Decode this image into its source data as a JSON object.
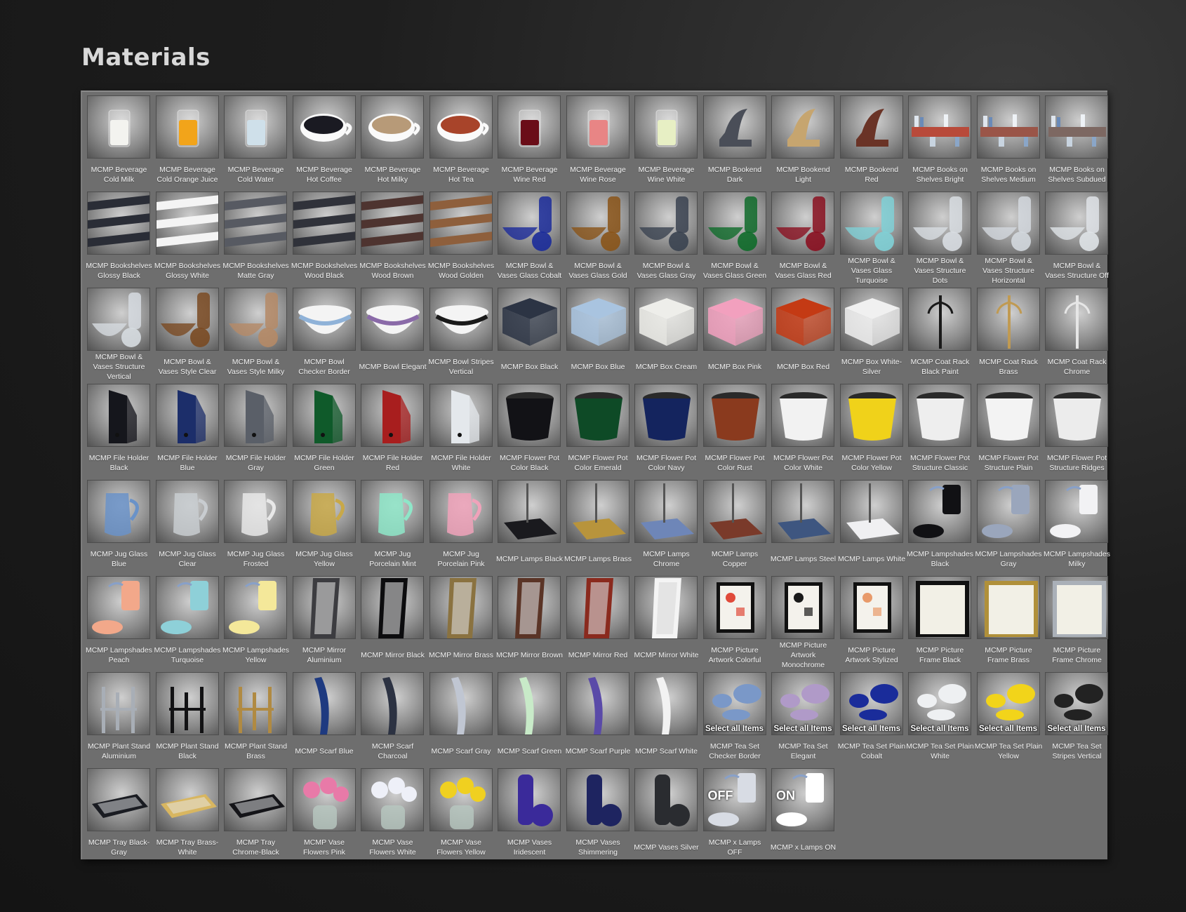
{
  "page": {
    "title": "Materials"
  },
  "columns": 15,
  "items": [
    {
      "label": "MCMP Beverage Cold Milk",
      "icon": "glass-milk-icon",
      "color": "#f3f3ef",
      "kind": "glass"
    },
    {
      "label": "MCMP Beverage Cold Orange Juice",
      "icon": "glass-orange-juice-icon",
      "color": "#f2a41a",
      "kind": "glass"
    },
    {
      "label": "MCMP Beverage Cold Water",
      "icon": "glass-water-icon",
      "color": "#cfe0ea",
      "kind": "glass"
    },
    {
      "label": "MCMP Beverage Hot Coffee",
      "icon": "cup-coffee-icon",
      "color": "#1a1a22",
      "kind": "cup"
    },
    {
      "label": "MCMP Beverage Hot Milky",
      "icon": "cup-milky-icon",
      "color": "#b79a78",
      "kind": "cup"
    },
    {
      "label": "MCMP Beverage Hot Tea",
      "icon": "cup-tea-icon",
      "color": "#a8442a",
      "kind": "cup"
    },
    {
      "label": "MCMP Beverage Wine Red",
      "icon": "wine-glass-red-icon",
      "color": "#6a0d18",
      "kind": "glass"
    },
    {
      "label": "MCMP Beverage Wine Rose",
      "icon": "wine-glass-rose-icon",
      "color": "#e88585",
      "kind": "glass"
    },
    {
      "label": "MCMP Beverage Wine White",
      "icon": "wine-glass-white-icon",
      "color": "#e7efc4",
      "kind": "glass"
    },
    {
      "label": "MCMP Bookend Dark",
      "icon": "bookend-dark-icon",
      "color": "#4a4e58",
      "kind": "bookend"
    },
    {
      "label": "MCMP Bookend Light",
      "icon": "bookend-light-icon",
      "color": "#c6a56f",
      "kind": "bookend"
    },
    {
      "label": "MCMP Bookend Red",
      "icon": "bookend-red-icon",
      "color": "#6a3326",
      "kind": "bookend"
    },
    {
      "label": "MCMP Books on Shelves Bright",
      "icon": "books-shelves-bright-icon",
      "color": "#b84a3a",
      "kind": "books"
    },
    {
      "label": "MCMP Books on Shelves Medium",
      "icon": "books-shelves-medium-icon",
      "color": "#9a5548",
      "kind": "books"
    },
    {
      "label": "MCMP Books on Shelves Subdued",
      "icon": "books-shelves-subdued-icon",
      "color": "#7d6862",
      "kind": "books"
    },
    {
      "label": "MCMP Bookshelves Glossy Black",
      "icon": "shelves-glossy-black-icon",
      "color": "#2a2d36",
      "kind": "shelves"
    },
    {
      "label": "MCMP Bookshelves Glossy White",
      "icon": "shelves-glossy-white-icon",
      "color": "#f4f4f4",
      "kind": "shelves"
    },
    {
      "label": "MCMP Bookshelves Matte Gray",
      "icon": "shelves-matte-gray-icon",
      "color": "#575a62",
      "kind": "shelves"
    },
    {
      "label": "MCMP Bookshelves Wood Black",
      "icon": "shelves-wood-black-icon",
      "color": "#30323a",
      "kind": "shelves"
    },
    {
      "label": "MCMP Bookshelves Wood Brown",
      "icon": "shelves-wood-brown-icon",
      "color": "#4e3430",
      "kind": "shelves"
    },
    {
      "label": "MCMP Bookshelves Wood Golden",
      "icon": "shelves-wood-golden-icon",
      "color": "#8e5f3c",
      "kind": "shelves"
    },
    {
      "label": "MCMP Bowl & Vases Glass Cobalt",
      "icon": "bowl-vases-cobalt-icon",
      "color": "#1b2b9a",
      "kind": "bowlvase"
    },
    {
      "label": "MCMP Bowl & Vases Glass Gold",
      "icon": "bowl-vases-gold-icon",
      "color": "#8a5418",
      "kind": "bowlvase"
    },
    {
      "label": "MCMP Bowl & Vases Glass Gray",
      "icon": "bowl-vases-gray-icon",
      "color": "#3a4250",
      "kind": "bowlvase"
    },
    {
      "label": "MCMP Bowl & Vases Glass Green",
      "icon": "bowl-vases-green-icon",
      "color": "#0f6b2a",
      "kind": "bowlvase"
    },
    {
      "label": "MCMP Bowl & Vases Glass Red",
      "icon": "bowl-vases-red-icon",
      "color": "#8a1020",
      "kind": "bowlvase"
    },
    {
      "label": "MCMP Bowl & Vases Glass Turquoise",
      "icon": "bowl-vases-turquoise-icon",
      "color": "#7fd0d6",
      "kind": "bowlvase"
    },
    {
      "label": "MCMP Bowl & Vases Structure Dots",
      "icon": "bowl-vases-dots-icon",
      "color": "#d8dde2",
      "kind": "bowlvase"
    },
    {
      "label": "MCMP Bowl & Vases Structure Horizontal",
      "icon": "bowl-vases-horizontal-icon",
      "color": "#d3d8de",
      "kind": "bowlvase"
    },
    {
      "label": "MCMP Bowl & Vases Structure Off",
      "icon": "bowl-vases-off-icon",
      "color": "#dfe3e7",
      "kind": "bowlvase"
    },
    {
      "label": "MCMP Bowl & Vases Structure Vertical",
      "icon": "bowl-vases-vertical-icon",
      "color": "#d6dbe0",
      "kind": "bowlvase"
    },
    {
      "label": "MCMP Bowl & Vases Style Clear",
      "icon": "bowl-vases-style-clear-icon",
      "color": "#7a4a22",
      "kind": "bowlvase"
    },
    {
      "label": "MCMP Bowl & Vases Style Milky",
      "icon": "bowl-vases-style-milky-icon",
      "color": "#b58a66",
      "kind": "bowlvase"
    },
    {
      "label": "MCMP Bowl Checker Border",
      "icon": "bowl-checker-border-icon",
      "color": "#8fb2d8",
      "kind": "bowl"
    },
    {
      "label": "MCMP Bowl Elegant",
      "icon": "bowl-elegant-icon",
      "color": "#8a6aa8",
      "kind": "bowl"
    },
    {
      "label": "MCMP Bowl Stripes Vertical",
      "icon": "bowl-stripes-vertical-icon",
      "color": "#1a1a1a",
      "kind": "bowl"
    },
    {
      "label": "MCMP Box Black",
      "icon": "box-black-icon",
      "color": "#2c3444",
      "kind": "box"
    },
    {
      "label": "MCMP Box Blue",
      "icon": "box-blue-icon",
      "color": "#a9c4e0",
      "kind": "box"
    },
    {
      "label": "MCMP Box Cream",
      "icon": "box-cream-icon",
      "color": "#eeeeea",
      "kind": "box"
    },
    {
      "label": "MCMP Box Pink",
      "icon": "box-pink-icon",
      "color": "#f2a0be",
      "kind": "box"
    },
    {
      "label": "MCMP Box Red",
      "icon": "box-red-icon",
      "color": "#c43a14",
      "kind": "box"
    },
    {
      "label": "MCMP Box White-Silver",
      "icon": "box-white-silver-icon",
      "color": "#f0f0f0",
      "kind": "box"
    },
    {
      "label": "MCMP Coat Rack Black Paint",
      "icon": "coat-rack-black-icon",
      "color": "#1a1a1a",
      "kind": "rack"
    },
    {
      "label": "MCMP Coat Rack Brass",
      "icon": "coat-rack-brass-icon",
      "color": "#c09a52",
      "kind": "rack"
    },
    {
      "label": "MCMP Coat Rack Chrome",
      "icon": "coat-rack-chrome-icon",
      "color": "#e6e6e6",
      "kind": "rack"
    },
    {
      "label": "MCMP File Holder Black",
      "icon": "file-holder-black-icon",
      "color": "#15161c",
      "kind": "file"
    },
    {
      "label": "MCMP File Holder Blue",
      "icon": "file-holder-blue-icon",
      "color": "#1c2e6a",
      "kind": "file"
    },
    {
      "label": "MCMP File Holder Gray",
      "icon": "file-holder-gray-icon",
      "color": "#5a5f68",
      "kind": "file"
    },
    {
      "label": "MCMP File Holder Green",
      "icon": "file-holder-green-icon",
      "color": "#0f5a2a",
      "kind": "file"
    },
    {
      "label": "MCMP File Holder Red",
      "icon": "file-holder-red-icon",
      "color": "#a81e1e",
      "kind": "file"
    },
    {
      "label": "MCMP File Holder White",
      "icon": "file-holder-white-icon",
      "color": "#e4e8ec",
      "kind": "file"
    },
    {
      "label": "MCMP Flower Pot Color Black",
      "icon": "flower-pot-black-icon",
      "color": "#121216",
      "kind": "pot"
    },
    {
      "label": "MCMP Flower Pot Color Emerald",
      "icon": "flower-pot-emerald-icon",
      "color": "#0e4a26",
      "kind": "pot"
    },
    {
      "label": "MCMP Flower Pot Color Navy",
      "icon": "flower-pot-navy-icon",
      "color": "#14245e",
      "kind": "pot"
    },
    {
      "label": "MCMP Flower Pot Color Rust",
      "icon": "flower-pot-rust-icon",
      "color": "#8a3a1e",
      "kind": "pot"
    },
    {
      "label": "MCMP Flower Pot Color White",
      "icon": "flower-pot-white-icon",
      "color": "#f2f2f2",
      "kind": "pot"
    },
    {
      "label": "MCMP Flower Pot Color Yellow",
      "icon": "flower-pot-yellow-icon",
      "color": "#f0d21a",
      "kind": "pot"
    },
    {
      "label": "MCMP Flower Pot Structure Classic",
      "icon": "flower-pot-classic-icon",
      "color": "#eeeeee",
      "kind": "pot"
    },
    {
      "label": "MCMP Flower Pot Structure Plain",
      "icon": "flower-pot-plain-icon",
      "color": "#f3f3f3",
      "kind": "pot"
    },
    {
      "label": "MCMP Flower Pot Structure Ridges",
      "icon": "flower-pot-ridges-icon",
      "color": "#ececec",
      "kind": "pot"
    },
    {
      "label": "MCMP Jug Glass Blue",
      "icon": "jug-glass-blue-icon",
      "color": "#6a92c8",
      "kind": "jug"
    },
    {
      "label": "MCMP Jug Glass Clear",
      "icon": "jug-glass-clear-icon",
      "color": "#c8ccd0",
      "kind": "jug"
    },
    {
      "label": "MCMP Jug Glass Frosted",
      "icon": "jug-glass-frosted-icon",
      "color": "#e8e8e8",
      "kind": "jug"
    },
    {
      "label": "MCMP Jug Glass Yellow",
      "icon": "jug-glass-yellow-icon",
      "color": "#c8a848",
      "kind": "jug"
    },
    {
      "label": "MCMP Jug Porcelain Mint",
      "icon": "jug-porcelain-mint-icon",
      "color": "#8ee6c8",
      "kind": "jug"
    },
    {
      "label": "MCMP Jug Porcelain Pink",
      "icon": "jug-porcelain-pink-icon",
      "color": "#f0a2ba",
      "kind": "jug"
    },
    {
      "label": "MCMP Lamps Black",
      "icon": "lamp-black-icon",
      "color": "#1a1a1e",
      "kind": "lamp"
    },
    {
      "label": "MCMP Lamps Brass",
      "icon": "lamp-brass-icon",
      "color": "#b8943c",
      "kind": "lamp"
    },
    {
      "label": "MCMP Lamps Chrome",
      "icon": "lamp-chrome-icon",
      "color": "#6e86b8",
      "kind": "lamp"
    },
    {
      "label": "MCMP Lamps Copper",
      "icon": "lamp-copper-icon",
      "color": "#7a3a2a",
      "kind": "lamp"
    },
    {
      "label": "MCMP Lamps Steel",
      "icon": "lamp-steel-icon",
      "color": "#3e5680",
      "kind": "lamp"
    },
    {
      "label": "MCMP Lamps White",
      "icon": "lamp-white-icon",
      "color": "#f0f0f2",
      "kind": "lamp"
    },
    {
      "label": "MCMP Lampshades Black",
      "icon": "lampshade-black-icon",
      "color": "#111114",
      "kind": "shade"
    },
    {
      "label": "MCMP Lampshades Gray",
      "icon": "lampshade-gray-icon",
      "color": "#9aa6bc",
      "kind": "shade"
    },
    {
      "label": "MCMP Lampshades Milky",
      "icon": "lampshade-milky-icon",
      "color": "#f2f2f4",
      "kind": "shade"
    },
    {
      "label": "MCMP Lampshades Peach",
      "icon": "lampshade-peach-icon",
      "color": "#f2a88a",
      "kind": "shade"
    },
    {
      "label": "MCMP Lampshades Turquoise",
      "icon": "lampshade-turquoise-icon",
      "color": "#8ed0d8",
      "kind": "shade"
    },
    {
      "label": "MCMP Lampshades Yellow",
      "icon": "lampshade-yellow-icon",
      "color": "#f4e89a",
      "kind": "shade"
    },
    {
      "label": "MCMP Mirror Aluminium",
      "icon": "mirror-aluminium-icon",
      "color": "#3c3c40",
      "kind": "mirror"
    },
    {
      "label": "MCMP Mirror Black",
      "icon": "mirror-black-icon",
      "color": "#0c0c0e",
      "kind": "mirror"
    },
    {
      "label": "MCMP Mirror Brass",
      "icon": "mirror-brass-icon",
      "color": "#8a7240",
      "kind": "mirror"
    },
    {
      "label": "MCMP Mirror Brown",
      "icon": "mirror-brown-icon",
      "color": "#5a3426",
      "kind": "mirror"
    },
    {
      "label": "MCMP Mirror Red",
      "icon": "mirror-red-icon",
      "color": "#8a2a1e",
      "kind": "mirror"
    },
    {
      "label": "MCMP Mirror White",
      "icon": "mirror-white-icon",
      "color": "#f4f4f4",
      "kind": "mirror"
    },
    {
      "label": "MCMP Picture Artwork Colorful",
      "icon": "picture-colorful-icon",
      "color": "#e04a3a",
      "kind": "picture"
    },
    {
      "label": "MCMP Picture Artwork Monochrome",
      "icon": "picture-monochrome-icon",
      "color": "#1a1a1a",
      "kind": "picture"
    },
    {
      "label": "MCMP Picture Artwork Stylized",
      "icon": "picture-stylized-icon",
      "color": "#e89a6a",
      "kind": "picture"
    },
    {
      "label": "MCMP Picture Frame Black",
      "icon": "frame-black-icon",
      "color": "#111111",
      "kind": "frame"
    },
    {
      "label": "MCMP Picture Frame Brass",
      "icon": "frame-brass-icon",
      "color": "#b0903a",
      "kind": "frame"
    },
    {
      "label": "MCMP Picture Frame Chrome",
      "icon": "frame-chrome-icon",
      "color": "#aab0b8",
      "kind": "frame"
    },
    {
      "label": "MCMP Plant Stand Aluminium",
      "icon": "plant-stand-aluminium-icon",
      "color": "#a8aeb6",
      "kind": "stand"
    },
    {
      "label": "MCMP Plant Stand Black",
      "icon": "plant-stand-black-icon",
      "color": "#121214",
      "kind": "stand"
    },
    {
      "label": "MCMP Plant Stand Brass",
      "icon": "plant-stand-brass-icon",
      "color": "#b08a42",
      "kind": "stand"
    },
    {
      "label": "MCMP Scarf Blue",
      "icon": "scarf-blue-icon",
      "color": "#1e3a80",
      "kind": "scarf"
    },
    {
      "label": "MCMP Scarf Charcoal",
      "icon": "scarf-charcoal-icon",
      "color": "#2c3242",
      "kind": "scarf"
    },
    {
      "label": "MCMP Scarf Gray",
      "icon": "scarf-gray-icon",
      "color": "#c0c6d2",
      "kind": "scarf"
    },
    {
      "label": "MCMP Scarf Green",
      "icon": "scarf-green-icon",
      "color": "#c8eac8",
      "kind": "scarf"
    },
    {
      "label": "MCMP Scarf Purple",
      "icon": "scarf-purple-icon",
      "color": "#5a4aa8",
      "kind": "scarf"
    },
    {
      "label": "MCMP Scarf White",
      "icon": "scarf-white-icon",
      "color": "#f2f2f2",
      "kind": "scarf"
    },
    {
      "label": "MCMP Tea Set Checker Border",
      "icon": "tea-set-checker-icon",
      "color": "#7a98c8",
      "kind": "tea",
      "tag": "Select all Items"
    },
    {
      "label": "MCMP Tea Set Elegant",
      "icon": "tea-set-elegant-icon",
      "color": "#b09ac8",
      "kind": "tea",
      "tag": "Select all Items"
    },
    {
      "label": "MCMP Tea Set Plain Cobalt",
      "icon": "tea-set-cobalt-icon",
      "color": "#1a2c9a",
      "kind": "tea",
      "tag": "Select all Items"
    },
    {
      "label": "MCMP Tea Set Plain White",
      "icon": "tea-set-white-icon",
      "color": "#eef0f2",
      "kind": "tea",
      "tag": "Select all Items"
    },
    {
      "label": "MCMP Tea Set Plain Yellow",
      "icon": "tea-set-yellow-icon",
      "color": "#f2d41a",
      "kind": "tea",
      "tag": "Select all Items"
    },
    {
      "label": "MCMP Tea Set Stripes Vertical",
      "icon": "tea-set-stripes-icon",
      "color": "#222222",
      "kind": "tea",
      "tag": "Select all Items"
    },
    {
      "label": "MCMP Tray Black-Gray",
      "icon": "tray-black-gray-icon",
      "color": "#1a1c22",
      "kind": "tray"
    },
    {
      "label": "MCMP Tray Brass-White",
      "icon": "tray-brass-white-icon",
      "color": "#d8b660",
      "kind": "tray"
    },
    {
      "label": "MCMP Tray Chrome-Black",
      "icon": "tray-chrome-black-icon",
      "color": "#141418",
      "kind": "tray"
    },
    {
      "label": "MCMP Vase Flowers Pink",
      "icon": "vase-flowers-pink-icon",
      "color": "#e87aa8",
      "kind": "flowers"
    },
    {
      "label": "MCMP Vase Flowers White",
      "icon": "vase-flowers-white-icon",
      "color": "#eef0f8",
      "kind": "flowers"
    },
    {
      "label": "MCMP Vase Flowers Yellow",
      "icon": "vase-flowers-yellow-icon",
      "color": "#f0d020",
      "kind": "flowers"
    },
    {
      "label": "MCMP Vases Iridescent",
      "icon": "vases-iridescent-icon",
      "color": "#3a2a9a",
      "kind": "vases"
    },
    {
      "label": "MCMP Vases Shimmering",
      "icon": "vases-shimmering-icon",
      "color": "#1e2460",
      "kind": "vases"
    },
    {
      "label": "MCMP Vases Silver",
      "icon": "vases-silver-icon",
      "color": "#2a2c30",
      "kind": "vases"
    },
    {
      "label": "MCMP x Lamps OFF",
      "icon": "lamps-off-icon",
      "color": "#d8dce4",
      "kind": "shade",
      "tag2": "OFF"
    },
    {
      "label": "MCMP x Lamps ON",
      "icon": "lamps-on-icon",
      "color": "#ffffff",
      "kind": "shade",
      "tag2": "ON"
    }
  ]
}
